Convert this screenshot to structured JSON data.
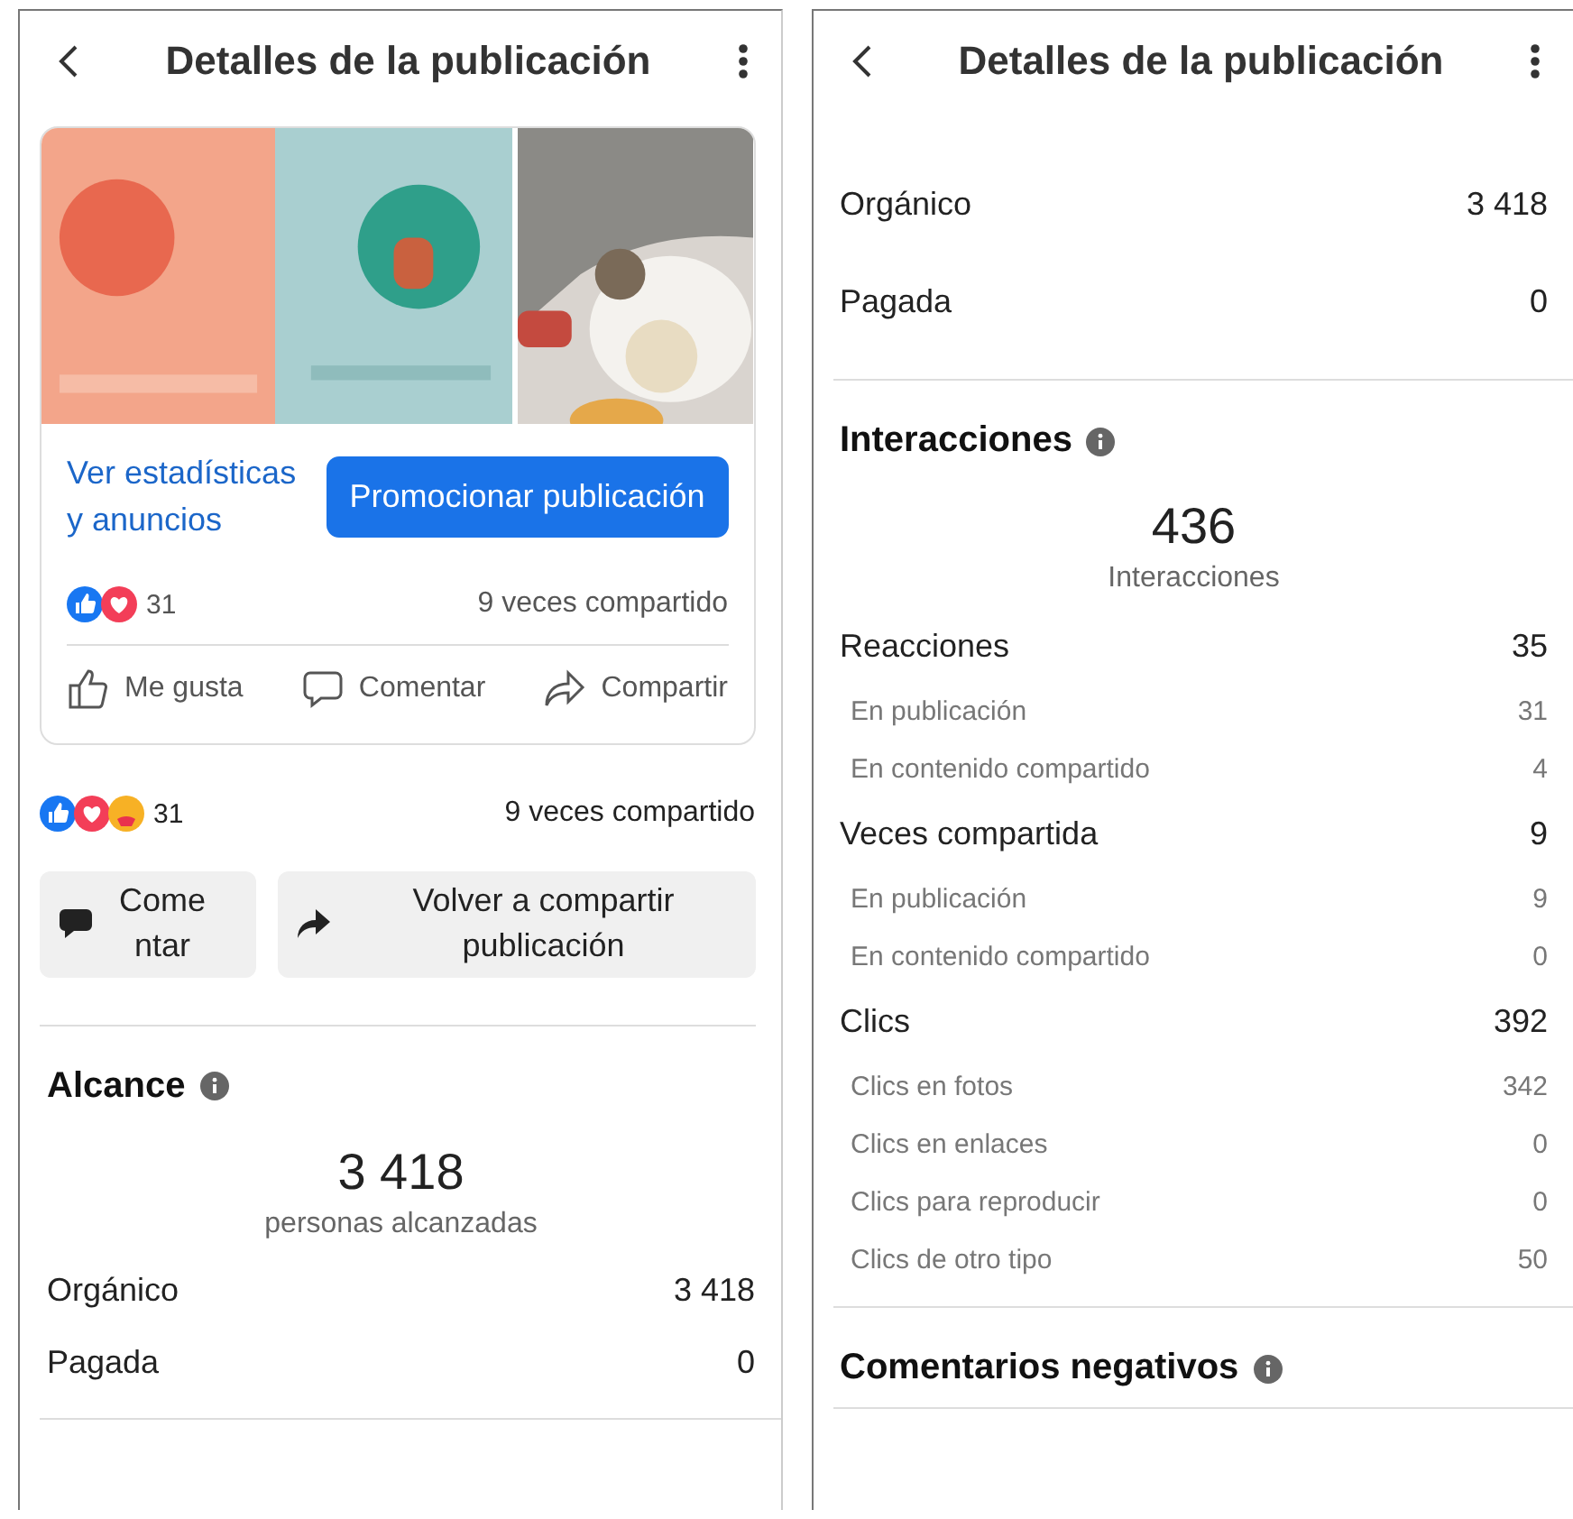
{
  "screens": [
    {
      "header": {
        "title": "Detalles de la publicación"
      },
      "post_card": {
        "link": "Ver estadísticas y anuncios",
        "button": "Promocionar publicación",
        "reaction_icons": [
          {
            "kind": "like"
          },
          {
            "kind": "love"
          }
        ],
        "reactions_count": "31",
        "shares": "9 veces compartido",
        "actions": [
          {
            "kind": "like",
            "label": "Me gusta"
          },
          {
            "kind": "comment",
            "label": "Comentar"
          },
          {
            "kind": "share",
            "label": "Compartir"
          }
        ]
      },
      "summary": {
        "reaction_icons": [
          {
            "kind": "like"
          },
          {
            "kind": "love"
          },
          {
            "kind": "care"
          }
        ],
        "reactions_count": "31",
        "shares": "9 veces compartido",
        "buttons": [
          {
            "kind": "comment",
            "label": "Comentar"
          },
          {
            "kind": "share",
            "label": "Volver a compartir publicación"
          }
        ]
      },
      "sections": [
        {
          "title": "Alcance",
          "total": "3 418",
          "caption": "personas alcanzadas",
          "rows": [
            {
              "label": "Orgánico",
              "value": "3 418"
            },
            {
              "label": "Pagada",
              "value": "0"
            }
          ]
        }
      ]
    },
    {
      "header": {
        "title": "Detalles de la publicación"
      },
      "rows": [
        {
          "label": "Orgánico",
          "value": "3 418"
        },
        {
          "label": "Pagada",
          "value": "0"
        }
      ],
      "sections": [
        {
          "title": "Interacciones",
          "total": "436",
          "caption": "Interacciones",
          "rows": [
            {
              "label": "Reacciones",
              "value": "35",
              "children": [
                {
                  "label": "En publicación",
                  "value": "31"
                },
                {
                  "label": "En contenido compartido",
                  "value": "4"
                }
              ]
            },
            {
              "label": "Veces compartida",
              "value": "9",
              "children": [
                {
                  "label": "En publicación",
                  "value": "9"
                },
                {
                  "label": "En contenido compartido",
                  "value": "0"
                }
              ]
            },
            {
              "label": "Clics",
              "value": "392",
              "children": [
                {
                  "label": "Clics en fotos",
                  "value": "342"
                },
                {
                  "label": "Clics en enlaces",
                  "value": "0"
                },
                {
                  "label": "Clics para reproducir",
                  "value": "0"
                },
                {
                  "label": "Clics de otro tipo",
                  "value": "50"
                }
              ]
            }
          ]
        },
        {
          "title": "Comentarios negativos"
        }
      ]
    }
  ]
}
